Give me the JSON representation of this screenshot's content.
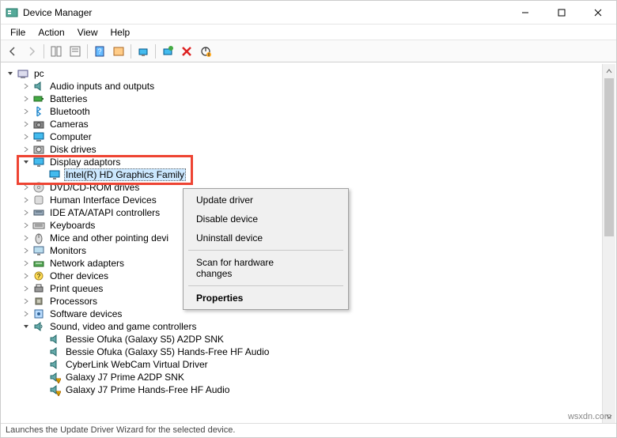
{
  "window": {
    "title": "Device Manager"
  },
  "menu": [
    "File",
    "Action",
    "View",
    "Help"
  ],
  "tree": {
    "root": "pc",
    "items": [
      {
        "label": "Audio inputs and outputs",
        "icon": "speaker",
        "exp": "right",
        "indent": 1
      },
      {
        "label": "Batteries",
        "icon": "battery",
        "exp": "right",
        "indent": 1
      },
      {
        "label": "Bluetooth",
        "icon": "bluetooth",
        "exp": "right",
        "indent": 1
      },
      {
        "label": "Cameras",
        "icon": "camera",
        "exp": "right",
        "indent": 1
      },
      {
        "label": "Computer",
        "icon": "computer",
        "exp": "right",
        "indent": 1
      },
      {
        "label": "Disk drives",
        "icon": "disk",
        "exp": "right",
        "indent": 1
      },
      {
        "label": "Display adaptors",
        "icon": "display",
        "exp": "down",
        "indent": 1
      },
      {
        "label": "Intel(R) HD Graphics Family",
        "icon": "display",
        "exp": "none",
        "indent": 2,
        "selected": true
      },
      {
        "label": "DVD/CD-ROM drives",
        "icon": "dvd",
        "exp": "right",
        "indent": 1
      },
      {
        "label": "Human Interface Devices",
        "icon": "hid",
        "exp": "right",
        "indent": 1
      },
      {
        "label": "IDE ATA/ATAPI controllers",
        "icon": "ide",
        "exp": "right",
        "indent": 1
      },
      {
        "label": "Keyboards",
        "icon": "keyboard",
        "exp": "right",
        "indent": 1
      },
      {
        "label": "Mice and other pointing devi",
        "icon": "mouse",
        "exp": "right",
        "indent": 1,
        "clip": true
      },
      {
        "label": "Monitors",
        "icon": "monitor",
        "exp": "right",
        "indent": 1
      },
      {
        "label": "Network adapters",
        "icon": "network",
        "exp": "right",
        "indent": 1
      },
      {
        "label": "Other devices",
        "icon": "other",
        "exp": "right",
        "indent": 1
      },
      {
        "label": "Print queues",
        "icon": "printer",
        "exp": "right",
        "indent": 1
      },
      {
        "label": "Processors",
        "icon": "cpu",
        "exp": "right",
        "indent": 1
      },
      {
        "label": "Software devices",
        "icon": "software",
        "exp": "right",
        "indent": 1
      },
      {
        "label": "Sound, video and game controllers",
        "icon": "sound",
        "exp": "down",
        "indent": 1
      },
      {
        "label": "Bessie Ofuka (Galaxy S5) A2DP SNK",
        "icon": "speaker",
        "exp": "none",
        "indent": 2
      },
      {
        "label": "Bessie Ofuka (Galaxy S5) Hands-Free HF Audio",
        "icon": "speaker",
        "exp": "none",
        "indent": 2
      },
      {
        "label": "CyberLink WebCam Virtual Driver",
        "icon": "speaker",
        "exp": "none",
        "indent": 2
      },
      {
        "label": "Galaxy J7 Prime A2DP SNK",
        "icon": "speaker-warn",
        "exp": "none",
        "indent": 2
      },
      {
        "label": "Galaxy J7 Prime Hands-Free HF Audio",
        "icon": "speaker-warn",
        "exp": "none",
        "indent": 2
      }
    ]
  },
  "context_menu": {
    "items": [
      {
        "label": "Update driver",
        "highlight": true
      },
      {
        "label": "Disable device"
      },
      {
        "label": "Uninstall device"
      },
      {
        "sep": true
      },
      {
        "label": "Scan for hardware changes"
      },
      {
        "sep": true
      },
      {
        "label": "Properties",
        "bold": true
      }
    ]
  },
  "statusbar": "Launches the Update Driver Wizard for the selected device.",
  "watermark": "wsxdn.com"
}
